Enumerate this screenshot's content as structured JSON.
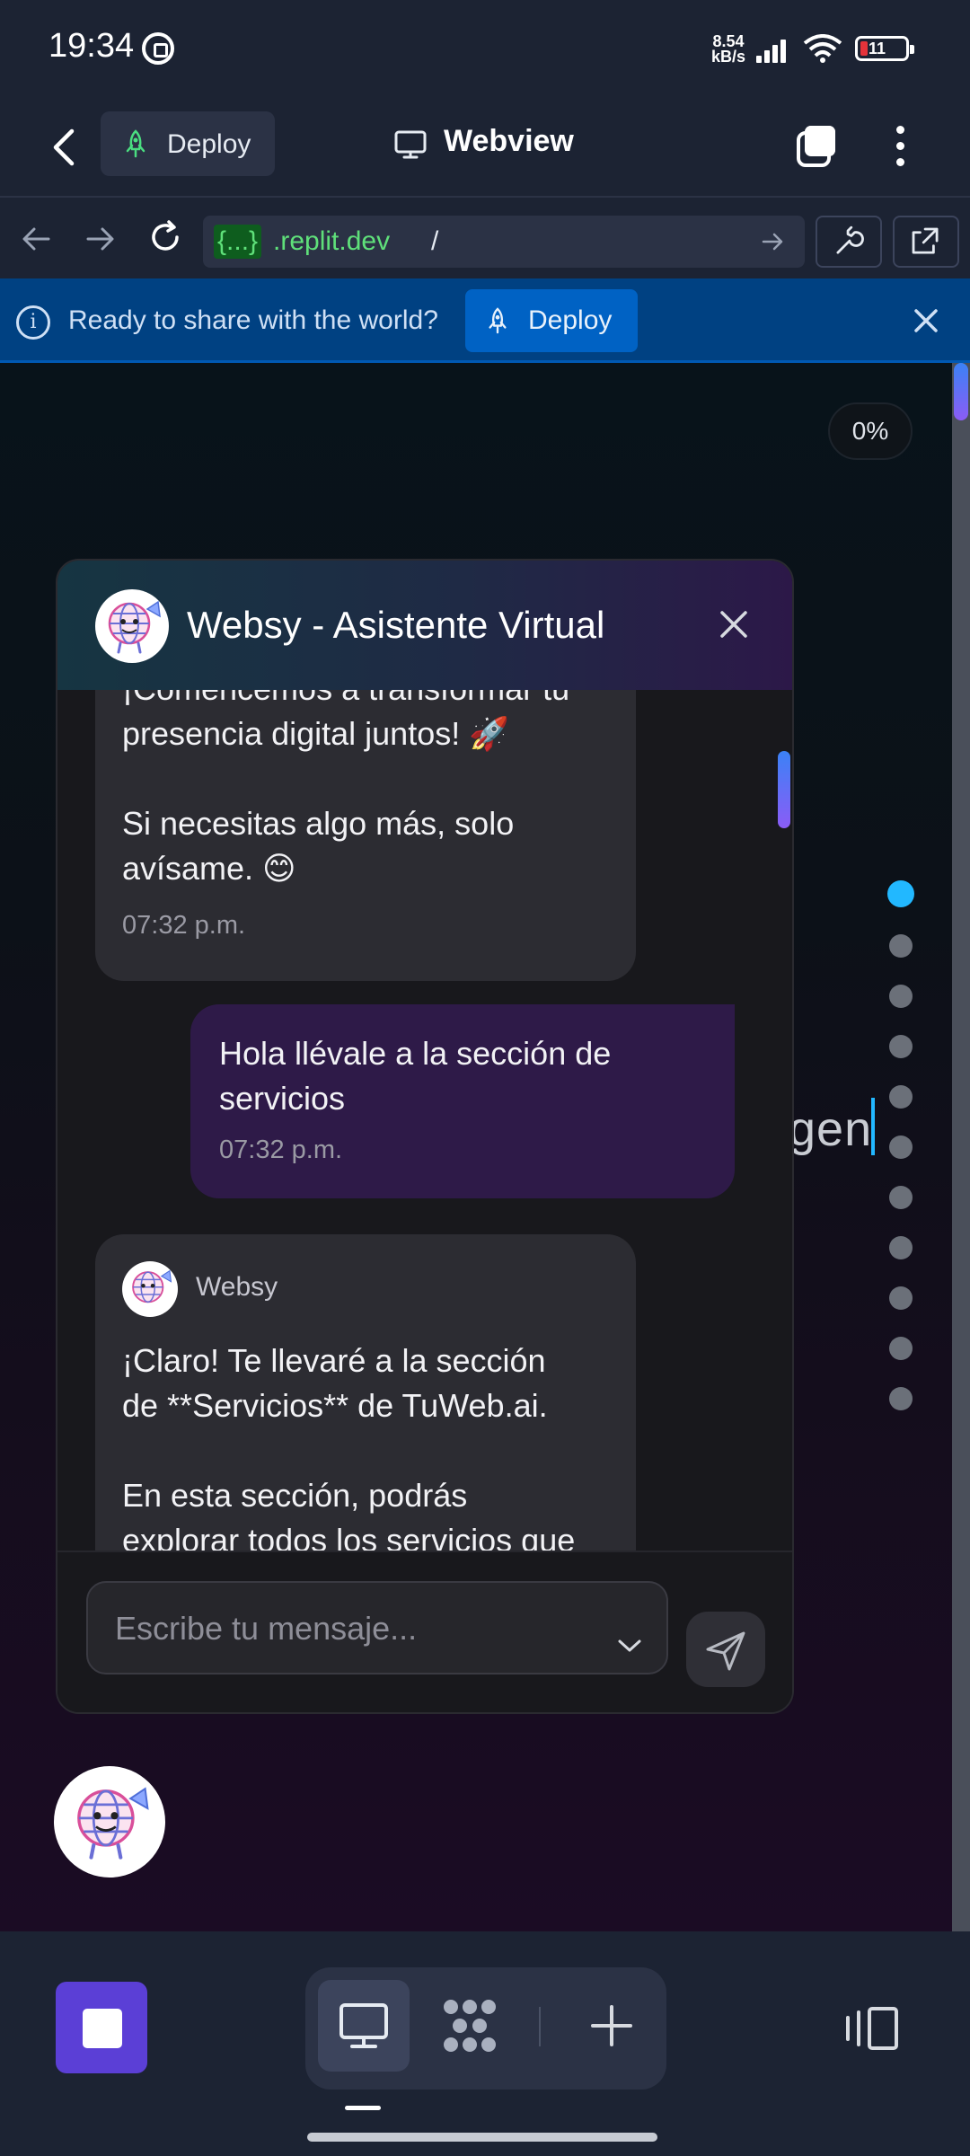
{
  "status_bar": {
    "time": "19:34",
    "net_speed_value": "8.54",
    "net_speed_unit": "kB/s",
    "battery": "11"
  },
  "header": {
    "deploy_label": "Deploy",
    "title": "Webview"
  },
  "url_bar": {
    "host_prefix": "{...}",
    "host": ".replit.dev",
    "path": "/"
  },
  "banner": {
    "text": "Ready to share with the world?",
    "deploy_label": "Deploy"
  },
  "webview": {
    "progress": "0%",
    "background_text": "gen",
    "section_dots_count": 11,
    "active_dot_color": "#22b8ff"
  },
  "chat": {
    "title": "Websy - Asistente Virtual",
    "messages": [
      {
        "sender": "bot",
        "text": "¡Comencemos a transformar tu\npresencia digital juntos! 🚀\n\nSi necesitas algo más, solo\navísame. 😊",
        "time": "07:32 p.m."
      },
      {
        "sender": "user",
        "text": "Hola llévale a la sección de\nservicios",
        "time": "07:32 p.m."
      },
      {
        "sender": "bot",
        "name": "Websy",
        "text": "¡Claro! Te llevaré a la sección\nde **Servicios** de TuWeb.ai.\n\nEn esta sección, podrás\nexplorar todos los servicios que"
      }
    ],
    "input_placeholder": "Escribe tu mensaje..."
  },
  "colors": {
    "accent_purple": "#5b3fd6",
    "banner_blue": "#004182",
    "url_green": "#5fe07a"
  }
}
